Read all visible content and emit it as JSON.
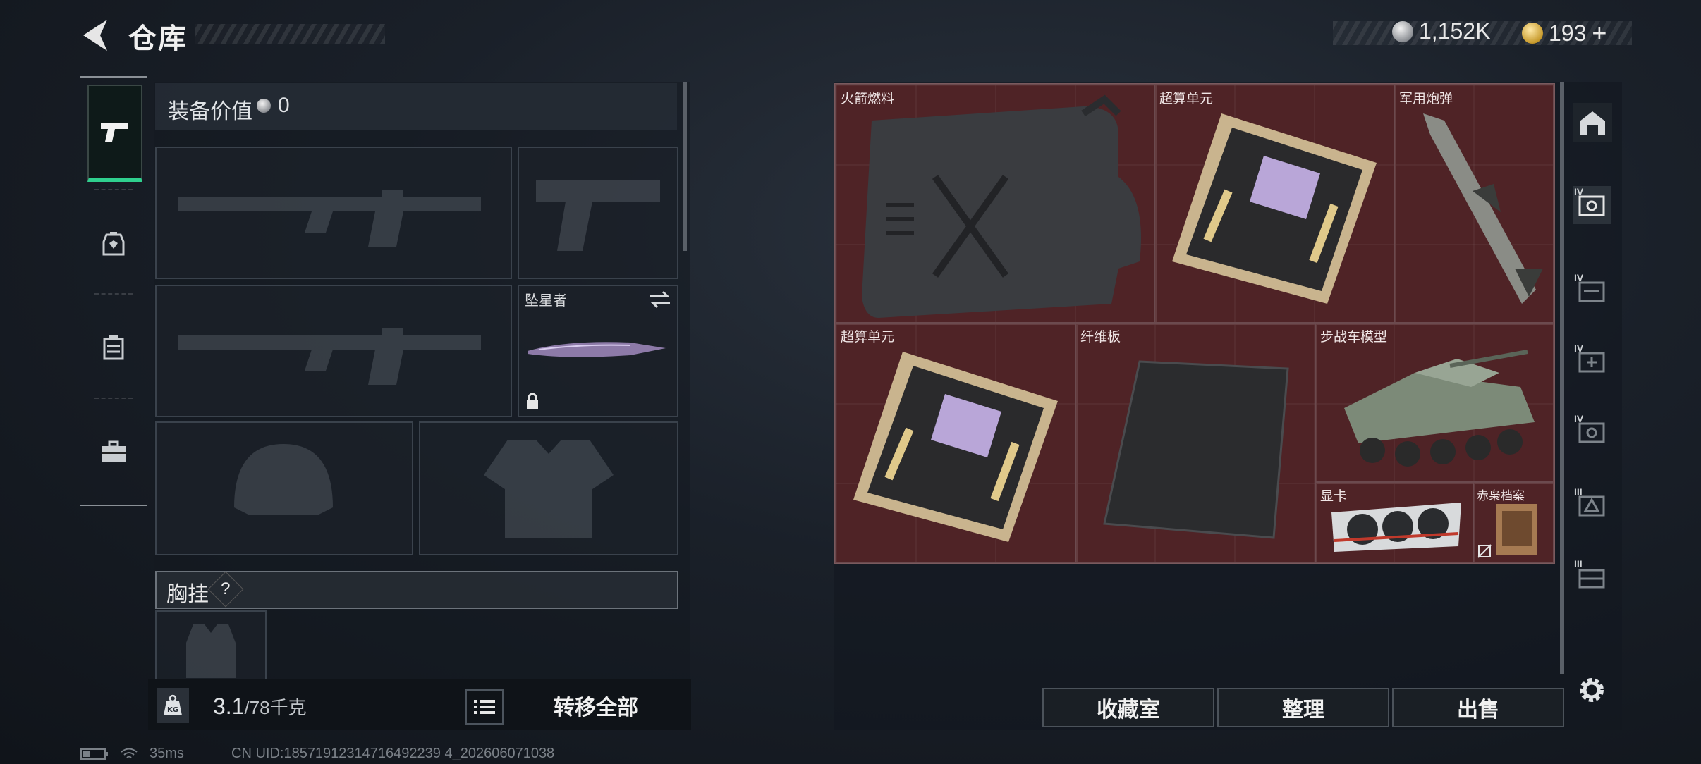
{
  "header": {
    "title": "仓库"
  },
  "currency": {
    "silver": "1,152K",
    "gold": "193",
    "add_symbol": "+"
  },
  "equipment": {
    "value_label": "装备价值",
    "value": "0",
    "secondary_weapon_name": "坠星者",
    "chest_rig_label": "胸挂",
    "help_symbol": "?",
    "weight_current": "3.1",
    "weight_max": "/78千克",
    "weight_badge": "KG",
    "transfer_all_label": "转移全部"
  },
  "storage": {
    "items": [
      {
        "name": "火箭燃料"
      },
      {
        "name": "超算单元"
      },
      {
        "name": "军用炮弹"
      },
      {
        "name": "超算单元"
      },
      {
        "name": "纤维板"
      },
      {
        "name": "步战车模型"
      },
      {
        "name": "显卡"
      },
      {
        "name": "赤枭档案"
      }
    ],
    "actions": {
      "collection": "收藏室",
      "organize": "整理",
      "sell": "出售"
    },
    "side_tiers": [
      "IV",
      "IV",
      "IV",
      "IV",
      "III",
      "III"
    ]
  },
  "status_bar": {
    "ping": "35ms",
    "uid": "CN UID:18571912314716492239 4_202606071038"
  },
  "colors": {
    "accent_green": "#2fd08e",
    "storage_bg": "#4a2326"
  }
}
